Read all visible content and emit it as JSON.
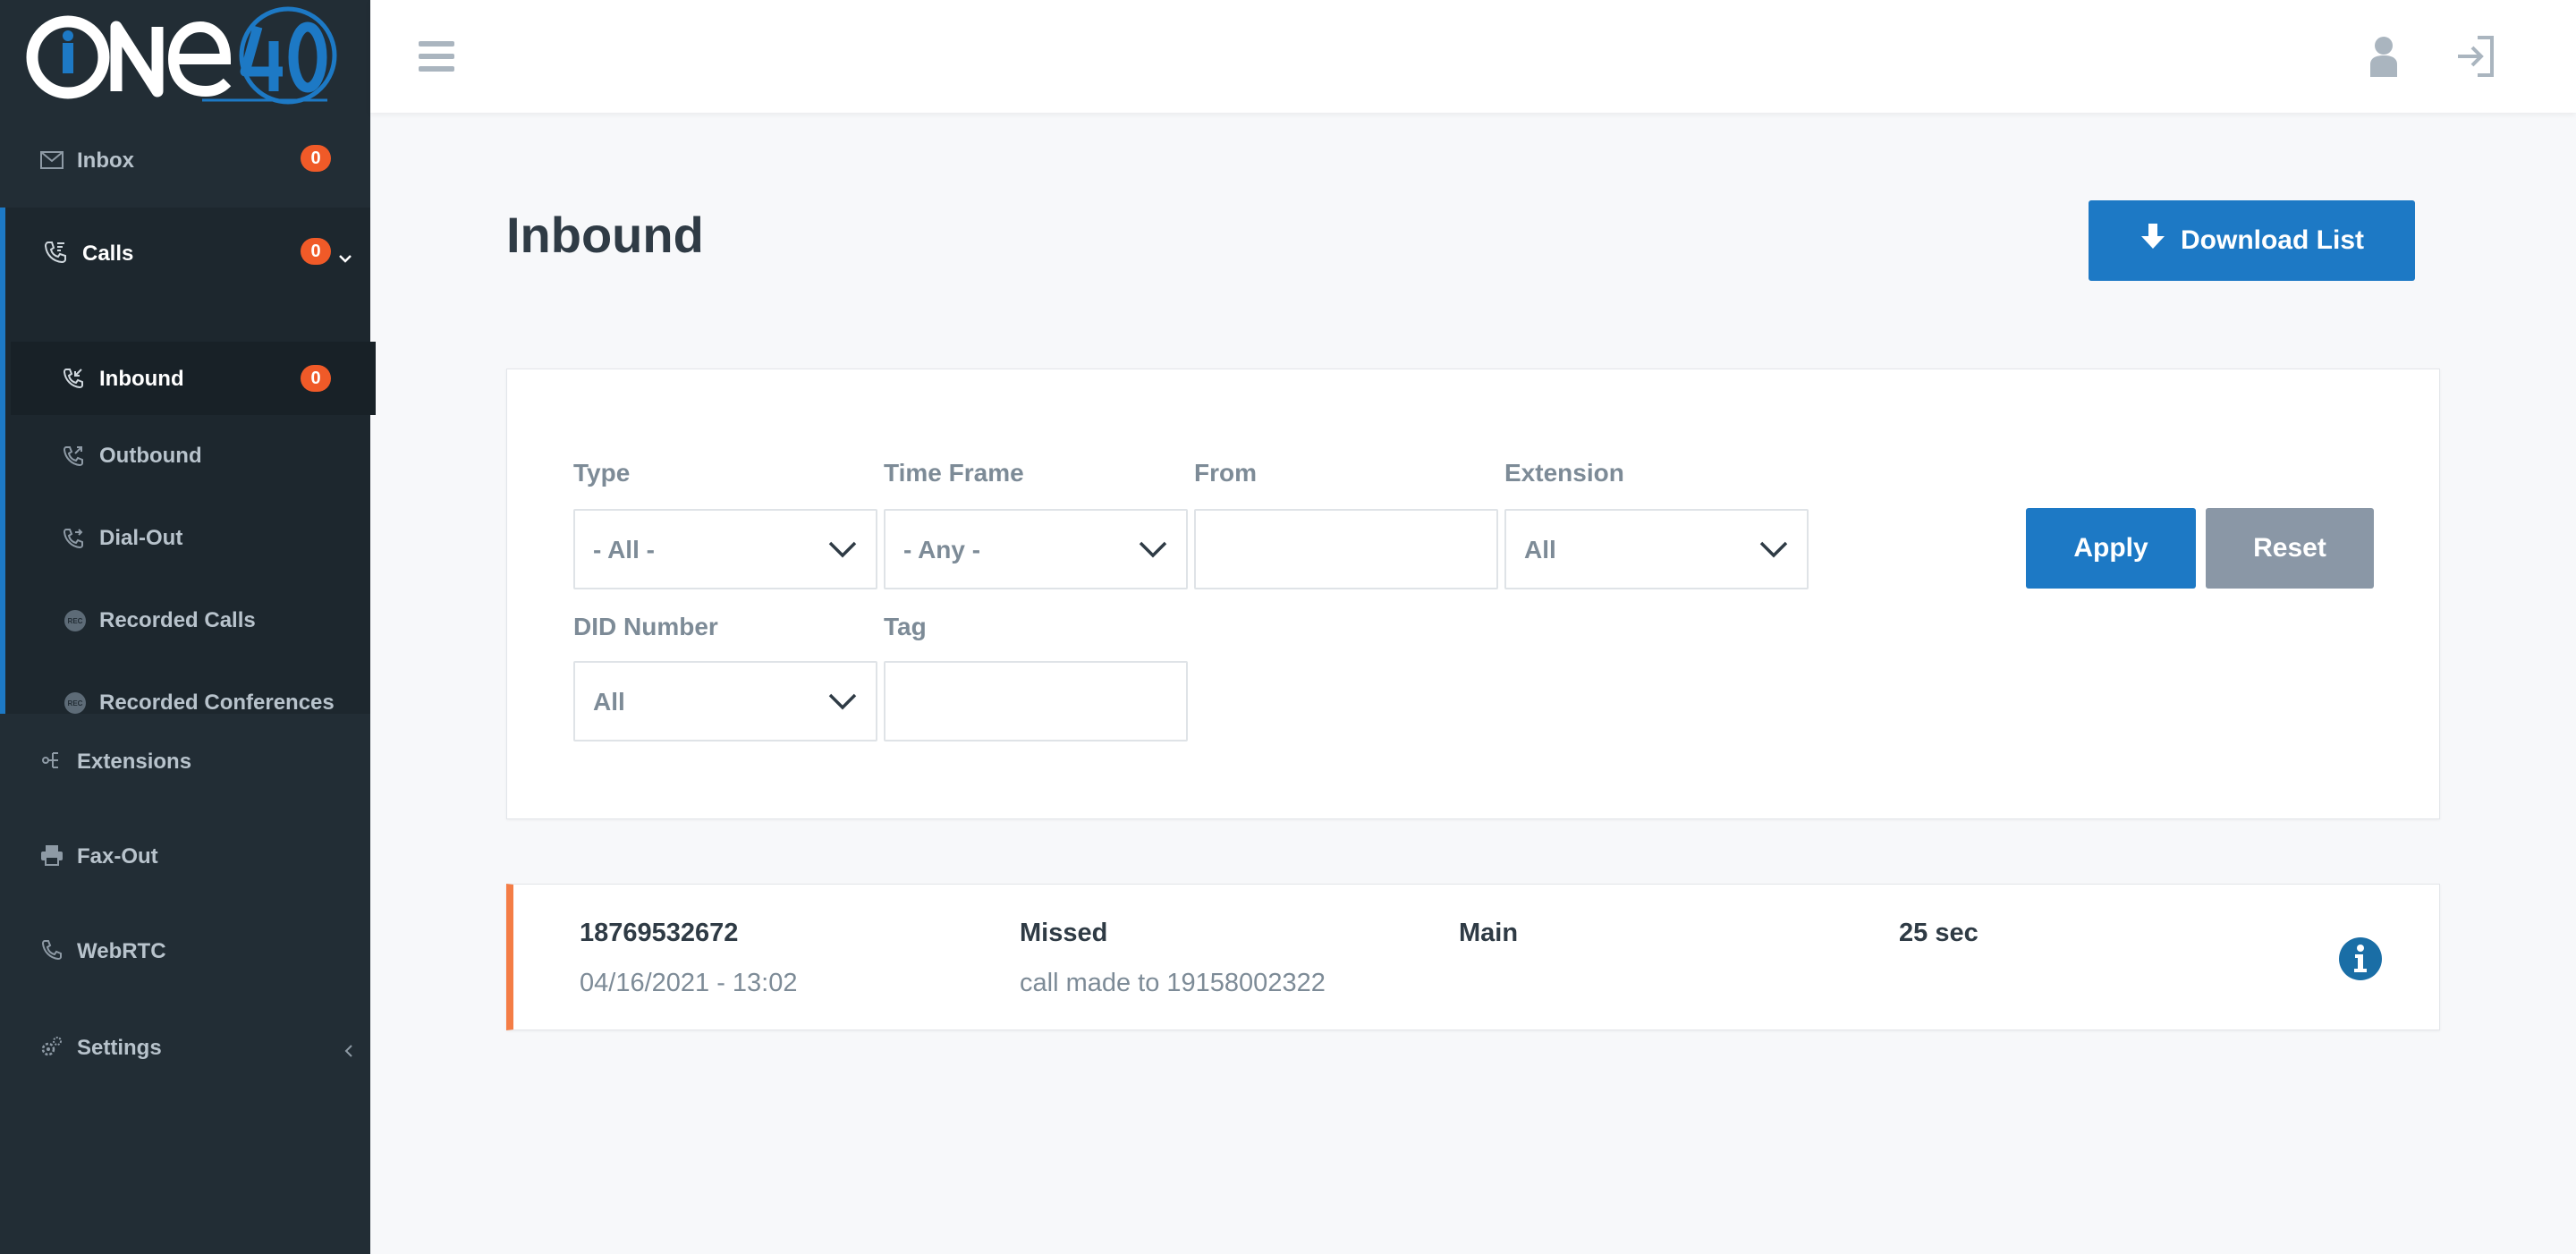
{
  "app": {
    "logo_text": "ONE40"
  },
  "sidebar": {
    "items": [
      {
        "label": "Inbox",
        "badge": "0",
        "icon": "envelope-icon"
      },
      {
        "label": "Calls",
        "badge": "0",
        "icon": "phone-icon"
      },
      {
        "label": "Extensions",
        "icon": "sitemap-icon"
      },
      {
        "label": "Fax-Out",
        "icon": "printer-icon"
      },
      {
        "label": "WebRTC",
        "icon": "phone-icon"
      },
      {
        "label": "Settings",
        "icon": "gear-icon"
      }
    ],
    "calls_sub": [
      {
        "label": "Inbound",
        "badge": "0",
        "icon": "phone-incoming-icon"
      },
      {
        "label": "Outbound",
        "icon": "phone-outgoing-icon"
      },
      {
        "label": "Dial-Out",
        "icon": "phone-icon"
      },
      {
        "label": "Recorded Calls",
        "icon": "rec-icon"
      },
      {
        "label": "Recorded Conferences",
        "icon": "rec-icon"
      }
    ]
  },
  "main": {
    "title": "Inbound",
    "download_label": "Download List"
  },
  "filters": {
    "type": {
      "label": "Type",
      "value": "- All -"
    },
    "timeframe": {
      "label": "Time Frame",
      "value": "- Any -"
    },
    "from": {
      "label": "From",
      "value": ""
    },
    "extension": {
      "label": "Extension",
      "value": "All"
    },
    "did": {
      "label": "DID Number",
      "value": "All"
    },
    "tag": {
      "label": "Tag",
      "value": ""
    },
    "apply_label": "Apply",
    "reset_label": "Reset"
  },
  "calls": [
    {
      "number": "18769532672",
      "datetime": "04/16/2021 - 13:02",
      "status": "Missed",
      "detail": "call made to 19158002322",
      "extension": "Main",
      "duration": "25 sec"
    }
  ],
  "colors": {
    "sidebar_bg": "#222d35",
    "accent": "#1d79c5",
    "badge": "#f05a28",
    "missed": "#f47d46",
    "reset": "#8a97a6"
  }
}
